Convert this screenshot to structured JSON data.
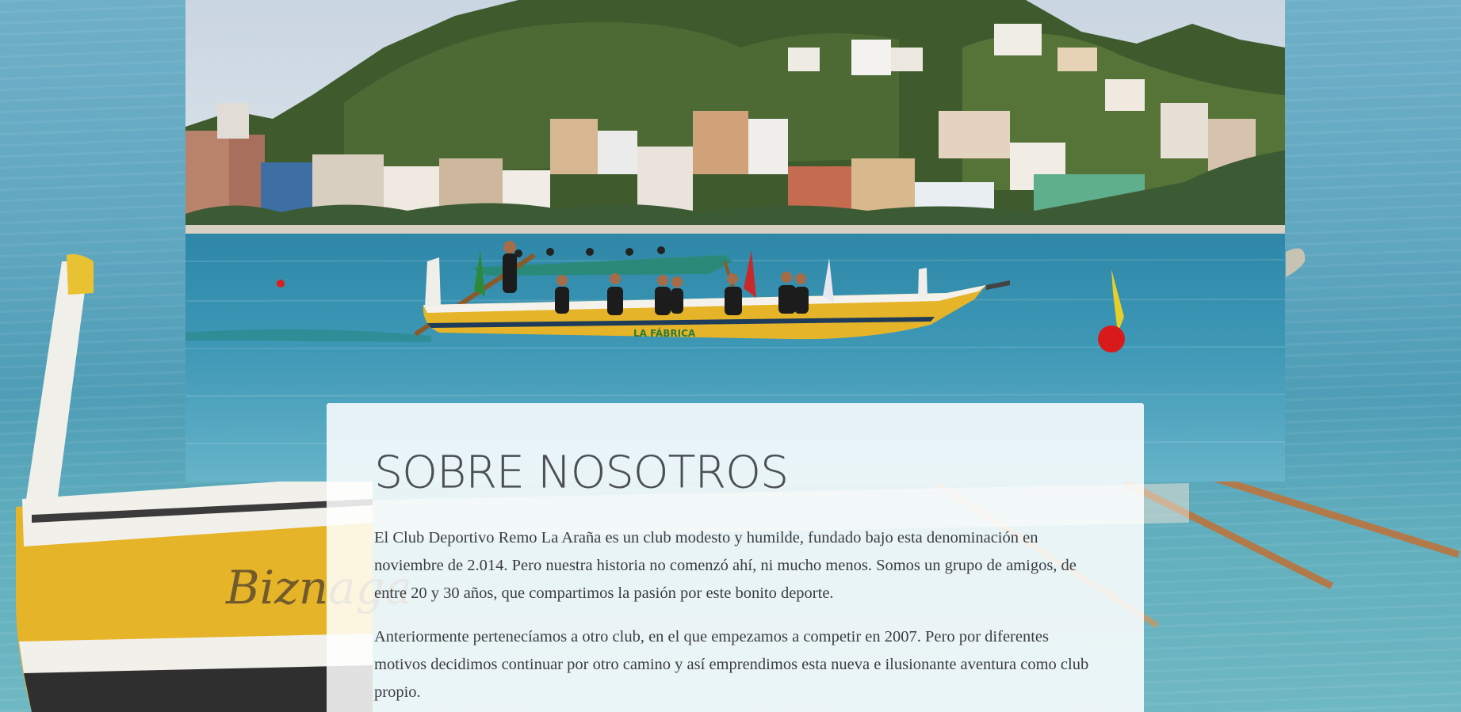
{
  "about": {
    "title": "SOBRE NOSOTROS",
    "paragraph_1": "El Club Deportivo Remo La Araña es un club modesto y humilde, fundado bajo esta denominación en noviembre de 2.014. Pero nuestra historia no comenzó ahí, ni mucho menos. Somos un grupo de amigos, de entre 20 y 30 años, que compartimos la pasión por este bonito deporte.",
    "paragraph_2": "Anteriormente pertenecíamos a otro club, en el que empezamos a competir en 2007. Pero por diferentes motivos decidimos continuar por otro camino y así emprendimos esta nueva e ilusionante aventura como club propio."
  },
  "background": {
    "boat_name": "Biznaga"
  },
  "hero": {
    "boat_sponsor_text": "LA FÁBRICA"
  },
  "colors": {
    "sea": "#5aa0b8",
    "boat_yellow": "#e5b429",
    "card_bg": "#ffffffdb",
    "title_text": "#4a4f55",
    "body_text": "#3a3d42"
  }
}
